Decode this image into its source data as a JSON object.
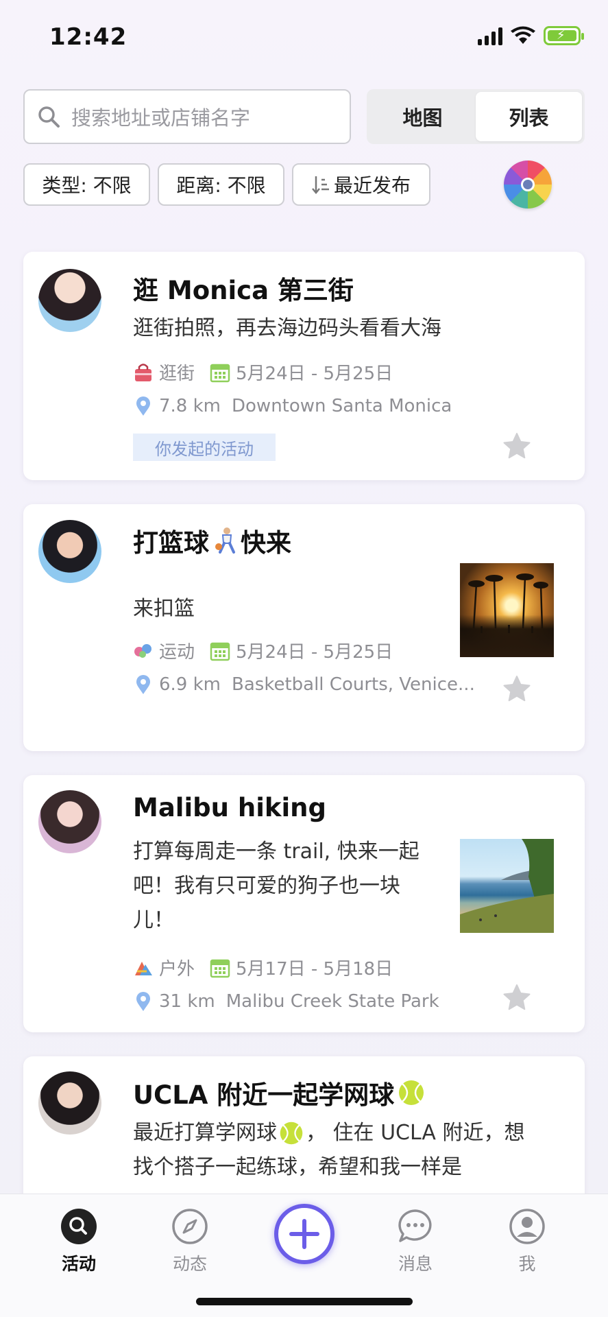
{
  "status": {
    "time": "12:42"
  },
  "search": {
    "placeholder": "搜索地址或店铺名字"
  },
  "view_toggle": {
    "map_label": "地图",
    "list_label": "列表",
    "selected": "列表"
  },
  "filters": {
    "type_label": "类型: 不限",
    "distance_label": "距离: 不限",
    "sort_label": "最近发布"
  },
  "posts": [
    {
      "title": "逛 Monica 第三街",
      "description": "逛街拍照，再去海边码头看看大海",
      "category": "逛街",
      "dates": "5月24日 - 5月25日",
      "distance": "7.8 km",
      "location": "Downtown Santa Monica",
      "badge": "你发起的活动"
    },
    {
      "title": "打篮球",
      "title_suffix": "快来",
      "description": "来扣篮",
      "category": "运动",
      "dates": "5月24日 - 5月25日",
      "distance": "6.9 km",
      "location": "Basketball Courts, Venice..."
    },
    {
      "title": "Malibu hiking",
      "description_lines": [
        "打算每周走一条 trail, 快来一起",
        "吧！我有只可爱的狗子也一块",
        "儿！"
      ],
      "category": "户外",
      "dates": "5月17日 - 5月18日",
      "distance": "31 km",
      "location": "Malibu Creek State Park"
    },
    {
      "title": "UCLA 附近一起学网球",
      "description_line1": "最近打算学网球",
      "description_line1b": "，  住在 UCLA 附近，想",
      "description_line2": "找个搭子一起练球，希望和我一样是"
    }
  ],
  "tabs": {
    "activity": "活动",
    "feed": "动态",
    "messages": "消息",
    "me": "我"
  },
  "colors": {
    "accent": "#6b5de8",
    "badge_bg": "#e6eefb",
    "badge_text": "#7f98cf",
    "calendar": "#8fcf5a",
    "pin": "#8fb8ef"
  }
}
